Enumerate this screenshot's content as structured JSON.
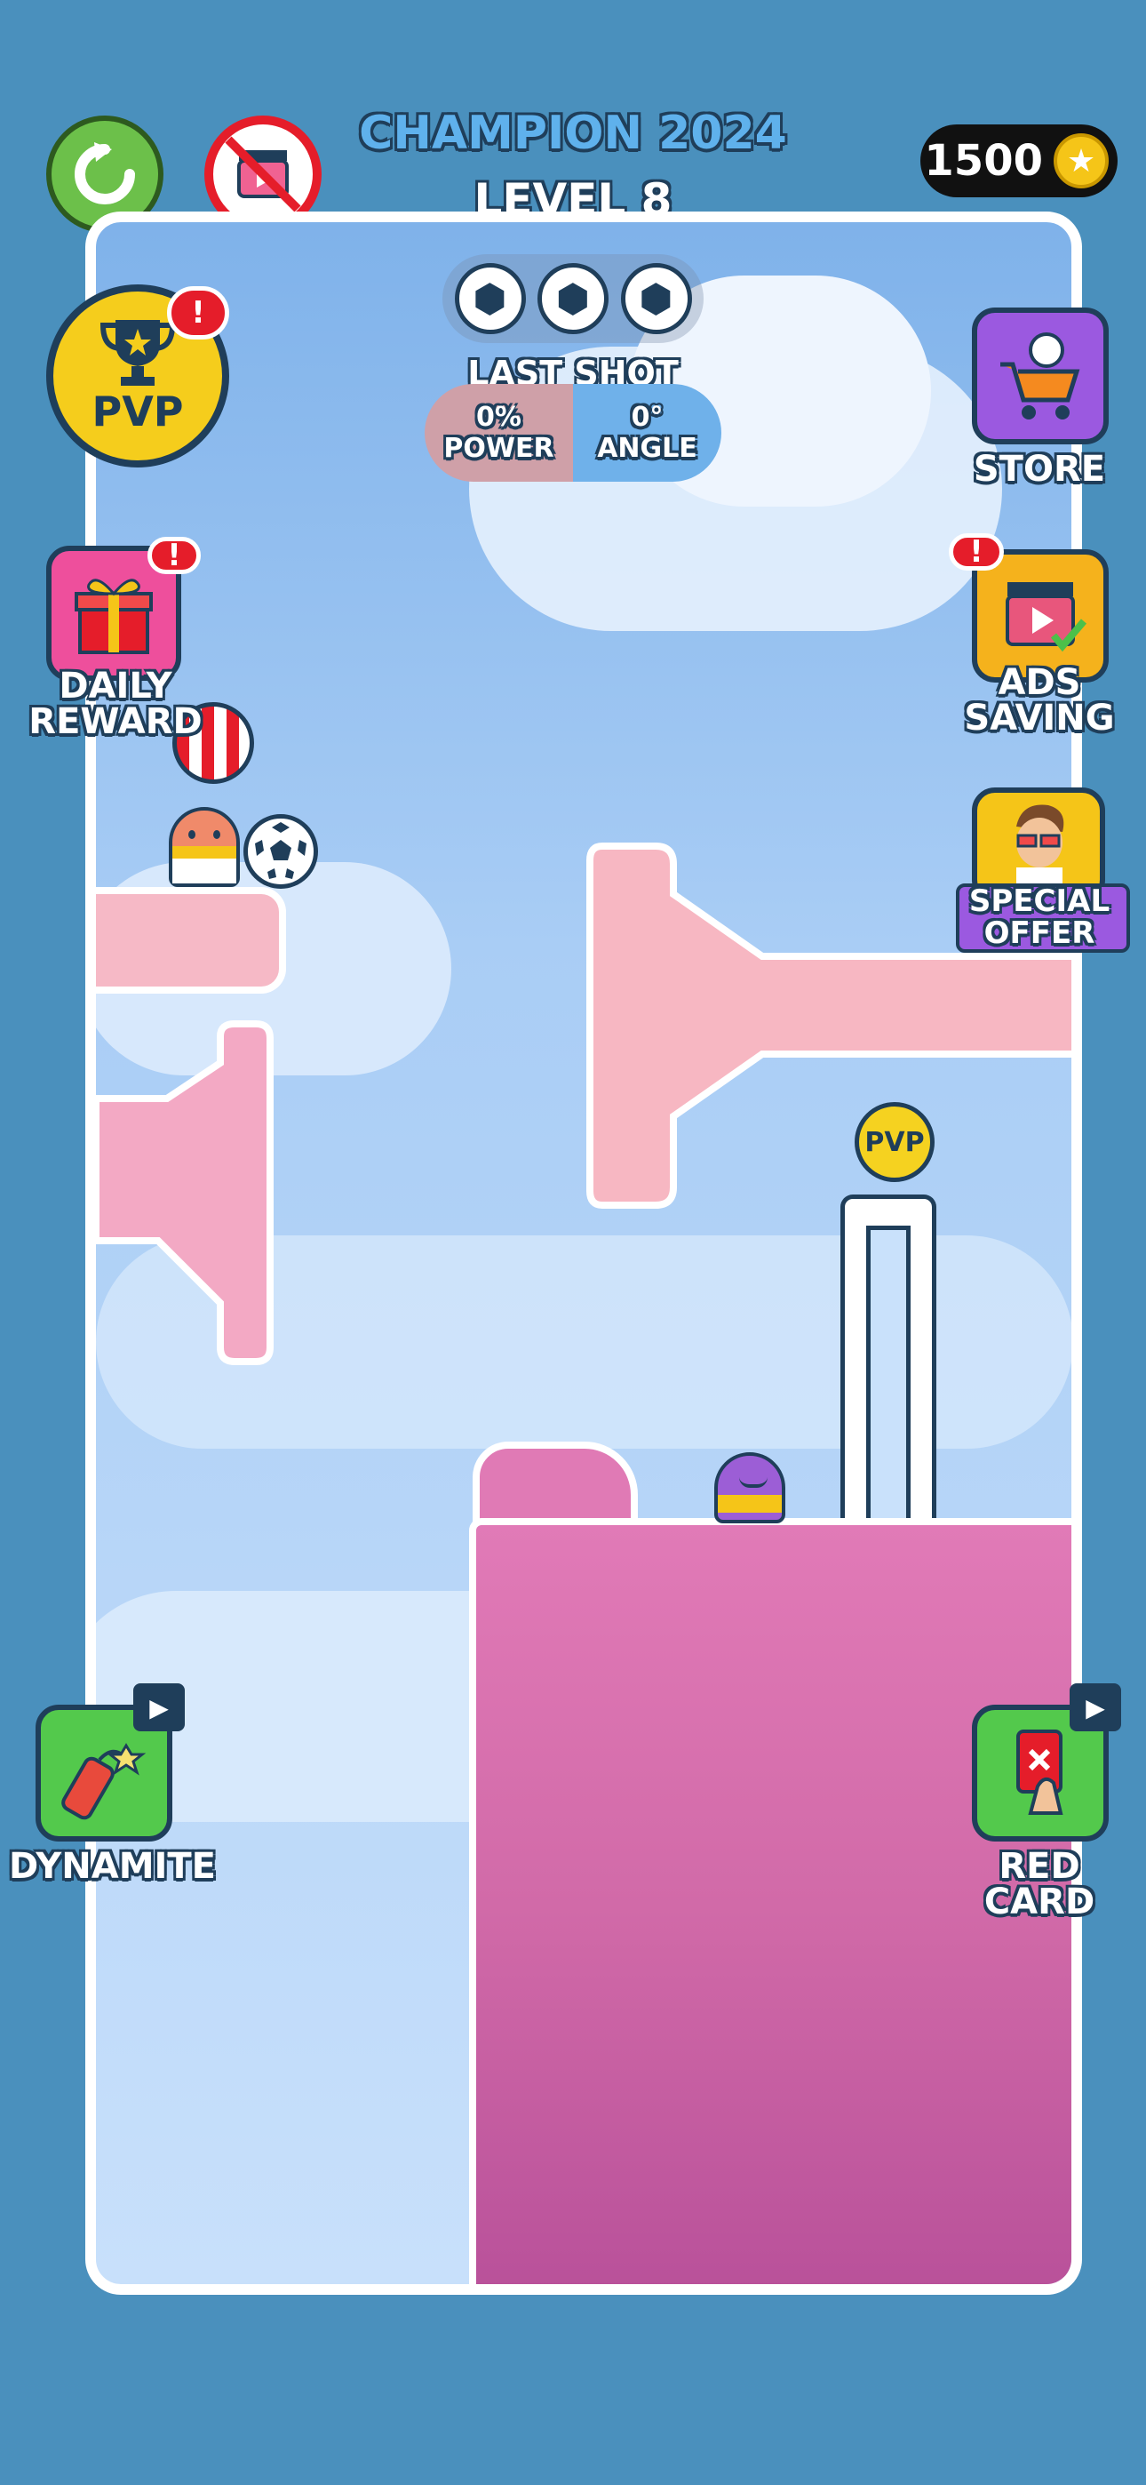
{
  "header": {
    "title": "CHAMPION 2024",
    "level": "LEVEL 8",
    "coins": "1500"
  },
  "shots": {
    "balls_remaining": 3
  },
  "last_shot": {
    "heading": "LAST SHOT",
    "power_value": "0%",
    "power_label": "POWER",
    "angle_value": "0°",
    "angle_label": "ANGLE"
  },
  "left_menu": {
    "pvp_label": "PVP",
    "daily_reward_label_1": "DAILY",
    "daily_reward_label_2": "REWARD",
    "dynamite_label": "DYNAMITE"
  },
  "right_menu": {
    "store_label": "STORE",
    "ads_saving_label_1": "ADS",
    "ads_saving_label_2": "SAVING",
    "special_offer_label_1": "SPECIAL",
    "special_offer_label_2": "OFFER",
    "red_card_label": "RED CARD"
  },
  "board": {
    "pvp_token_label": "PVP"
  },
  "colors": {
    "background": "#4a90bd",
    "accent_green": "#5cc94a",
    "accent_red": "#e51d2a",
    "gold": "#f5c518",
    "pink_block": "#f4b4c8",
    "magenta_block": "#d768a8",
    "purple_store": "#9b59e0"
  }
}
